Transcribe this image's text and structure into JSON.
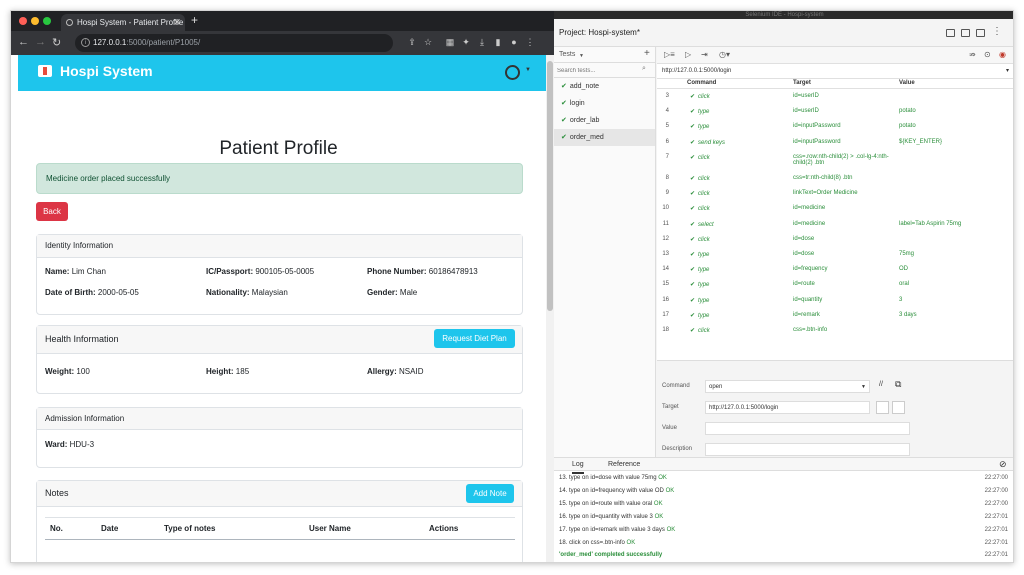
{
  "browser": {
    "tab_title": "Hospi System - Patient Profile",
    "url_host": "127.0.0.1",
    "url_path": ":5000/patient/P1005/"
  },
  "app": {
    "brand": "Hospi System",
    "page_title": "Patient Profile",
    "alert": "Medicine order placed successfully",
    "back_label": "Back",
    "identity": {
      "header": "Identity Information",
      "name_label": "Name:",
      "name": "Lim Chan",
      "ic_label": "IC/Passport:",
      "ic": "900105-05-0005",
      "phone_label": "Phone Number:",
      "phone": "60186478913",
      "dob_label": "Date of Birth:",
      "dob": "2000-05-05",
      "nationality_label": "Nationality:",
      "nationality": "Malaysian",
      "gender_label": "Gender:",
      "gender": "Male"
    },
    "health": {
      "header": "Health Information",
      "diet_button": "Request Diet Plan",
      "weight_label": "Weight:",
      "weight": "100",
      "height_label": "Height:",
      "height": "185",
      "allergy_label": "Allergy:",
      "allergy": "NSAID"
    },
    "admission": {
      "header": "Admission Information",
      "ward_label": "Ward:",
      "ward": "HDU-3"
    },
    "notes": {
      "header": "Notes",
      "add_button": "Add Note",
      "columns": [
        "No.",
        "Date",
        "Type of notes",
        "User Name",
        "Actions"
      ]
    }
  },
  "ide": {
    "window_title": "Selenium IDE - Hospi-system",
    "project_label": "Project:",
    "project": "Hospi-system*",
    "tests_label": "Tests",
    "search_placeholder": "Search tests...",
    "tests": [
      "add_note",
      "login",
      "order_lab",
      "order_med"
    ],
    "selected_test": "order_med",
    "base_url": "http://127.0.0.1:5000/login",
    "grid_headers": [
      "Command",
      "Target",
      "Value"
    ],
    "rows": [
      {
        "n": "3",
        "cmd": "click",
        "target": "id=userID",
        "value": ""
      },
      {
        "n": "4",
        "cmd": "type",
        "target": "id=userID",
        "value": "potato"
      },
      {
        "n": "5",
        "cmd": "type",
        "target": "id=inputPassword",
        "value": "potato"
      },
      {
        "n": "6",
        "cmd": "send keys",
        "target": "id=inputPassword",
        "value": "${KEY_ENTER}"
      },
      {
        "n": "7",
        "cmd": "click",
        "target": "css=.row:nth-child(2) > .col-lg-4:nth-child(2) .btn",
        "value": ""
      },
      {
        "n": "8",
        "cmd": "click",
        "target": "css=tr:nth-child(8) .btn",
        "value": ""
      },
      {
        "n": "9",
        "cmd": "click",
        "target": "linkText=Order Medicine",
        "value": ""
      },
      {
        "n": "10",
        "cmd": "click",
        "target": "id=medicine",
        "value": ""
      },
      {
        "n": "11",
        "cmd": "select",
        "target": "id=medicine",
        "value": "label=Tab Aspirin 75mg"
      },
      {
        "n": "12",
        "cmd": "click",
        "target": "id=dose",
        "value": ""
      },
      {
        "n": "13",
        "cmd": "type",
        "target": "id=dose",
        "value": "75mg"
      },
      {
        "n": "14",
        "cmd": "type",
        "target": "id=frequency",
        "value": "OD"
      },
      {
        "n": "15",
        "cmd": "type",
        "target": "id=route",
        "value": "oral"
      },
      {
        "n": "16",
        "cmd": "type",
        "target": "id=quantity",
        "value": "3"
      },
      {
        "n": "17",
        "cmd": "type",
        "target": "id=remark",
        "value": "3 days"
      },
      {
        "n": "18",
        "cmd": "click",
        "target": "css=.btn-info",
        "value": ""
      }
    ],
    "command_label": "Command",
    "command_value": "open",
    "target_label": "Target",
    "target_value": "http://127.0.0.1:5000/login",
    "value_label": "Value",
    "description_label": "Description",
    "log_tab": "Log",
    "reference_tab": "Reference",
    "log": [
      {
        "msg": "13. type on id=dose with value 75mg",
        "status": "OK",
        "time": "22:27:00"
      },
      {
        "msg": "14. type on id=frequency with value OD",
        "status": "OK",
        "time": "22:27:00"
      },
      {
        "msg": "15. type on id=route with value oral",
        "status": "OK",
        "time": "22:27:00"
      },
      {
        "msg": "16. type on id=quantity with value 3",
        "status": "OK",
        "time": "22:27:01"
      },
      {
        "msg": "17. type on id=remark with value 3 days",
        "status": "OK",
        "time": "22:27:01"
      },
      {
        "msg": "18. click on css=.btn-info",
        "status": "OK",
        "time": "22:27:01"
      },
      {
        "msg": "'order_med' completed successfully",
        "status": "",
        "time": "22:27:01"
      }
    ]
  }
}
